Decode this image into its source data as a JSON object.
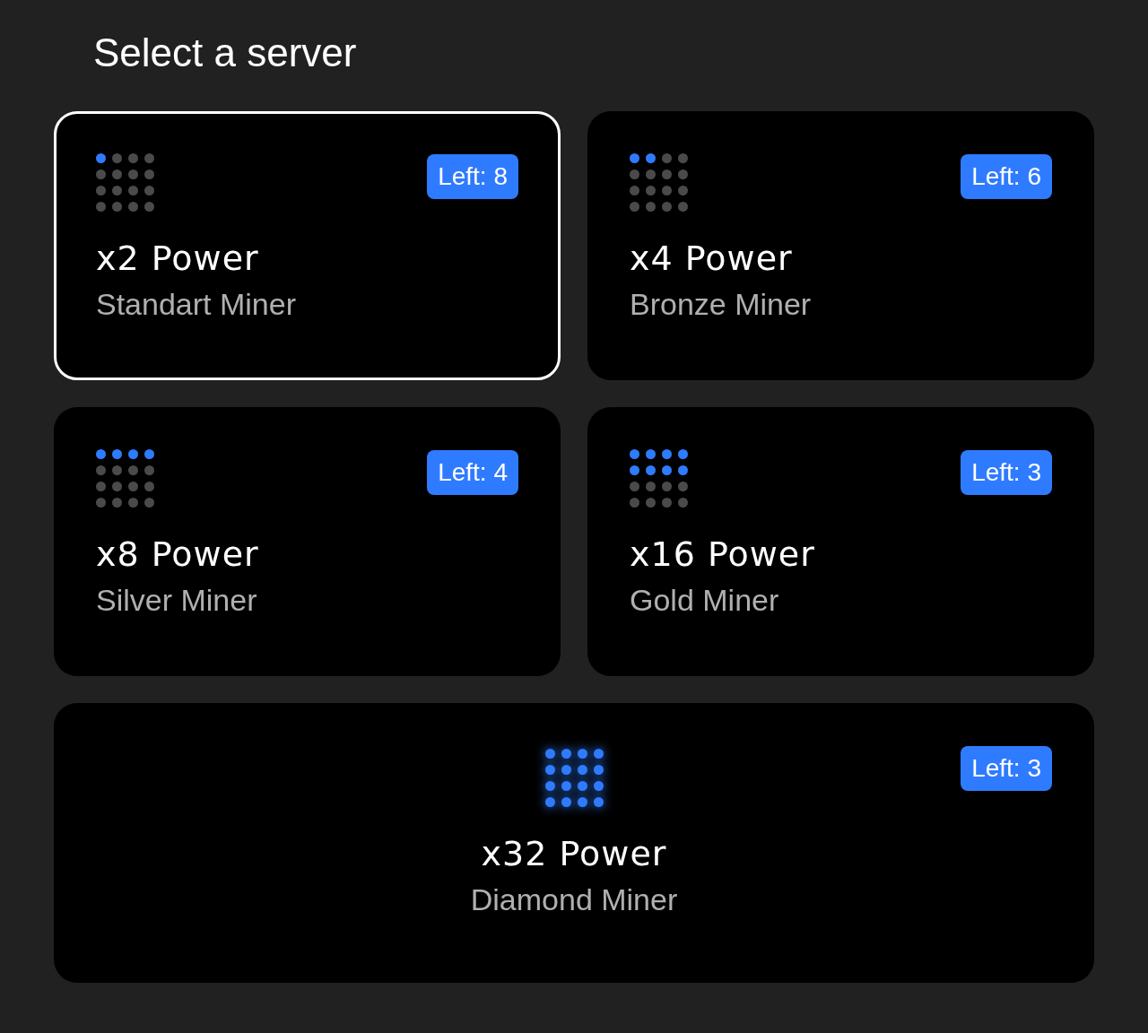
{
  "title": "Select a server",
  "cards": [
    {
      "kind": "standard",
      "selected": true,
      "badge": "Left: 8",
      "power": "x2 Power",
      "tier": "Standart Miner"
    },
    {
      "kind": "bronze",
      "selected": false,
      "badge": "Left: 6",
      "power": "x4 Power",
      "tier": "Bronze Miner"
    },
    {
      "kind": "silver",
      "selected": false,
      "badge": "Left: 4",
      "power": "x8 Power",
      "tier": "Silver Miner"
    },
    {
      "kind": "gold",
      "selected": false,
      "badge": "Left: 3",
      "power": "x16 Power",
      "tier": "Gold Miner"
    },
    {
      "kind": "diamond",
      "selected": false,
      "badge": "Left: 3",
      "power": "x32 Power",
      "tier": "Diamond Miner"
    }
  ]
}
